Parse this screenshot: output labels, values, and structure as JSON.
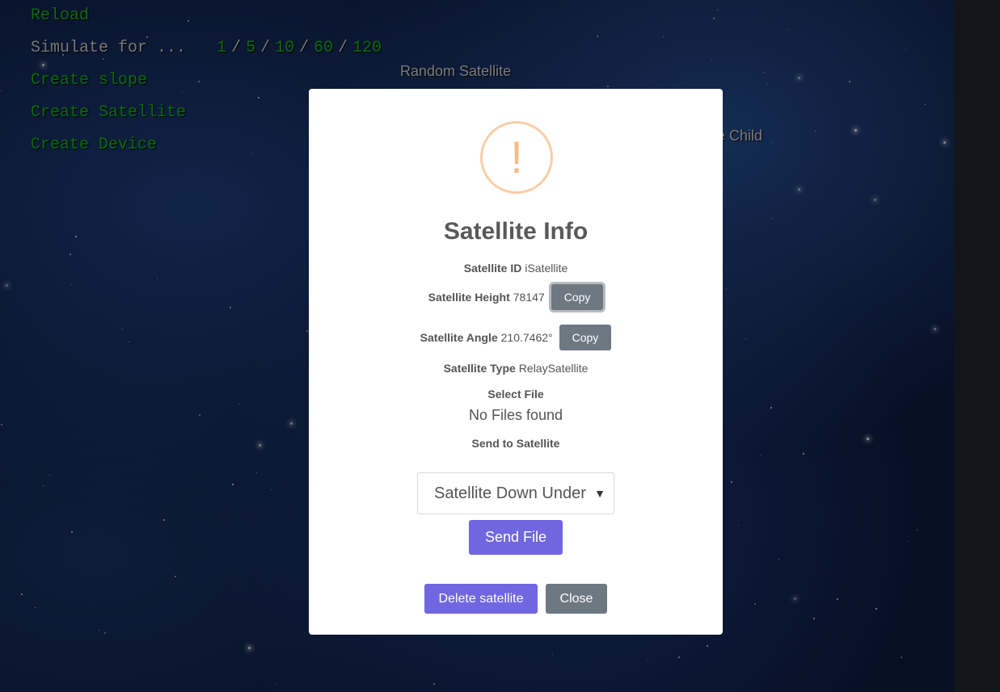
{
  "menu": {
    "reload": "Reload",
    "simulate_label": "Simulate for ...",
    "simulate_options": [
      "1",
      "5",
      "10",
      "60",
      "120"
    ],
    "create_slope": "Create slope",
    "create_satellite": "Create Satellite",
    "create_device": "Create Device"
  },
  "scene": {
    "random_satellite_label": "Random Satellite",
    "satellite_child_label_partial": "ite Child"
  },
  "modal": {
    "icon_glyph": "!",
    "title": "Satellite Info",
    "satellite_id_label": "Satellite ID",
    "satellite_id_value": "iSatellite",
    "height_label": "Satellite Height",
    "height_value": "78147",
    "angle_label": "Satellite Angle",
    "angle_value": "210.7462°",
    "type_label": "Satellite Type",
    "type_value": "RelaySatellite",
    "copy_label": "Copy",
    "select_file_label": "Select File",
    "no_files_text": "No Files found",
    "send_to_label": "Send to Satellite",
    "selected_satellite": "Satellite Down Under",
    "send_file_label": "Send File",
    "delete_label": "Delete satellite",
    "close_label": "Close"
  },
  "colors": {
    "menu_green": "#17b317",
    "primary": "#7066e0",
    "secondary": "#6e7881",
    "warning_icon": "#f8bb86"
  }
}
